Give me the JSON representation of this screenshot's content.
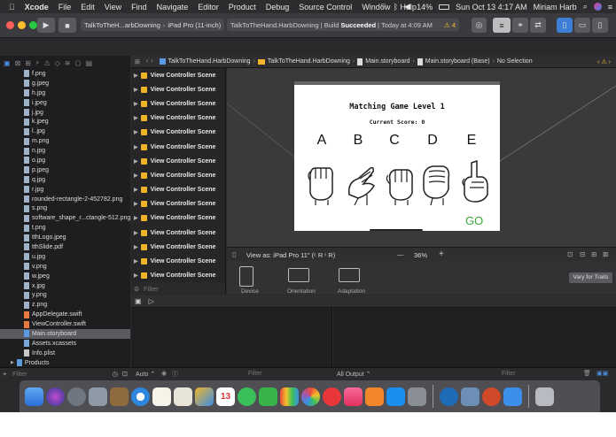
{
  "menubar": {
    "apple": "",
    "app": "Xcode",
    "items": [
      "File",
      "Edit",
      "View",
      "Find",
      "Navigate",
      "Editor",
      "Product",
      "Debug",
      "Source Control",
      "Window",
      "Help"
    ],
    "battery": "14%",
    "clock": "Sun Oct 13  4:17 AM",
    "user": "Miriam Harb"
  },
  "toolbar": {
    "scheme": "TalkToTheH...arbDowning",
    "device": "iPad Pro (11-inch)",
    "status_prefix": "TalkToTheHand.HarbDowning | Build",
    "status_bold": "Succeeded",
    "status_suffix": "| Today at 4:09 AM",
    "warnings": "⚠ 4"
  },
  "navigator": {
    "files": [
      {
        "name": "f.png",
        "kind": "img"
      },
      {
        "name": "g.jpeg",
        "kind": "img"
      },
      {
        "name": "h.jpg",
        "kind": "img"
      },
      {
        "name": "i.jpeg",
        "kind": "img"
      },
      {
        "name": "j.jpg",
        "kind": "img"
      },
      {
        "name": "k.jpeg",
        "kind": "img"
      },
      {
        "name": "l..jpg",
        "kind": "img"
      },
      {
        "name": "m.png",
        "kind": "img"
      },
      {
        "name": "n.jpg",
        "kind": "img"
      },
      {
        "name": "o.jpg",
        "kind": "img"
      },
      {
        "name": "p.jpeg",
        "kind": "img"
      },
      {
        "name": "q.jpg",
        "kind": "img"
      },
      {
        "name": "r.jpg",
        "kind": "img"
      },
      {
        "name": "rounded-rectangle-2-452782.png",
        "kind": "img"
      },
      {
        "name": "s.png",
        "kind": "img"
      },
      {
        "name": "software_shape_r...ctangle-512.png",
        "kind": "img"
      },
      {
        "name": "t.png",
        "kind": "img"
      },
      {
        "name": "tthLogo.jpeg",
        "kind": "img"
      },
      {
        "name": "tthSlide.pdf",
        "kind": "img"
      },
      {
        "name": "u.jpg",
        "kind": "img"
      },
      {
        "name": "v.png",
        "kind": "img"
      },
      {
        "name": "w.jpeg",
        "kind": "img"
      },
      {
        "name": "x.jpg",
        "kind": "img"
      },
      {
        "name": "y.png",
        "kind": "img"
      },
      {
        "name": "z.png",
        "kind": "img"
      },
      {
        "name": "AppDelegate.swift",
        "kind": "swift"
      },
      {
        "name": "ViewController.swift",
        "kind": "swift"
      },
      {
        "name": "Main.storyboard",
        "kind": "sb",
        "selected": true
      },
      {
        "name": "Assets.xcassets",
        "kind": "xca"
      },
      {
        "name": "Info.plist",
        "kind": "plist"
      },
      {
        "name": "Products",
        "kind": "fold",
        "folder": true
      }
    ],
    "filter_placeholder": "Filter"
  },
  "jumpbar": {
    "crumbs": [
      "TalkToTheHand.HarbDowning",
      "TalkToTheHand.HarbDowning",
      "Main.storyboard",
      "Main.storyboard (Base)",
      "No Selection"
    ]
  },
  "outline": {
    "scene_label": "View Controller Scene",
    "scene_count": 15,
    "filter_placeholder": "Filter"
  },
  "ipad": {
    "title": "Matching Game Level 1",
    "score": "Current Score: 0",
    "letters": [
      "A",
      "B",
      "C",
      "D",
      "E"
    ],
    "go": "GO"
  },
  "devicebar": {
    "view_as": "View as: iPad Pro 11\" (ᶜ R ʳ R)",
    "zoom": "36%",
    "minus": "—",
    "plus": "+"
  },
  "devicepanel": {
    "device": "Device",
    "orientation": "Orientation",
    "adaptation": "Adaptation",
    "vary": "Vary for Traits"
  },
  "debugfoot": {
    "auto": "Auto ⌃",
    "filter_left": "Filter",
    "all_output": "All Output ⌃",
    "filter_right": "Filter"
  },
  "dock": {
    "calendar_day": "13"
  },
  "colors": {
    "go_green": "#3aa83a",
    "selection": "#5a5b60",
    "traffic_red": "#fe5f57",
    "traffic_yellow": "#febc2e",
    "traffic_green": "#28c840"
  }
}
